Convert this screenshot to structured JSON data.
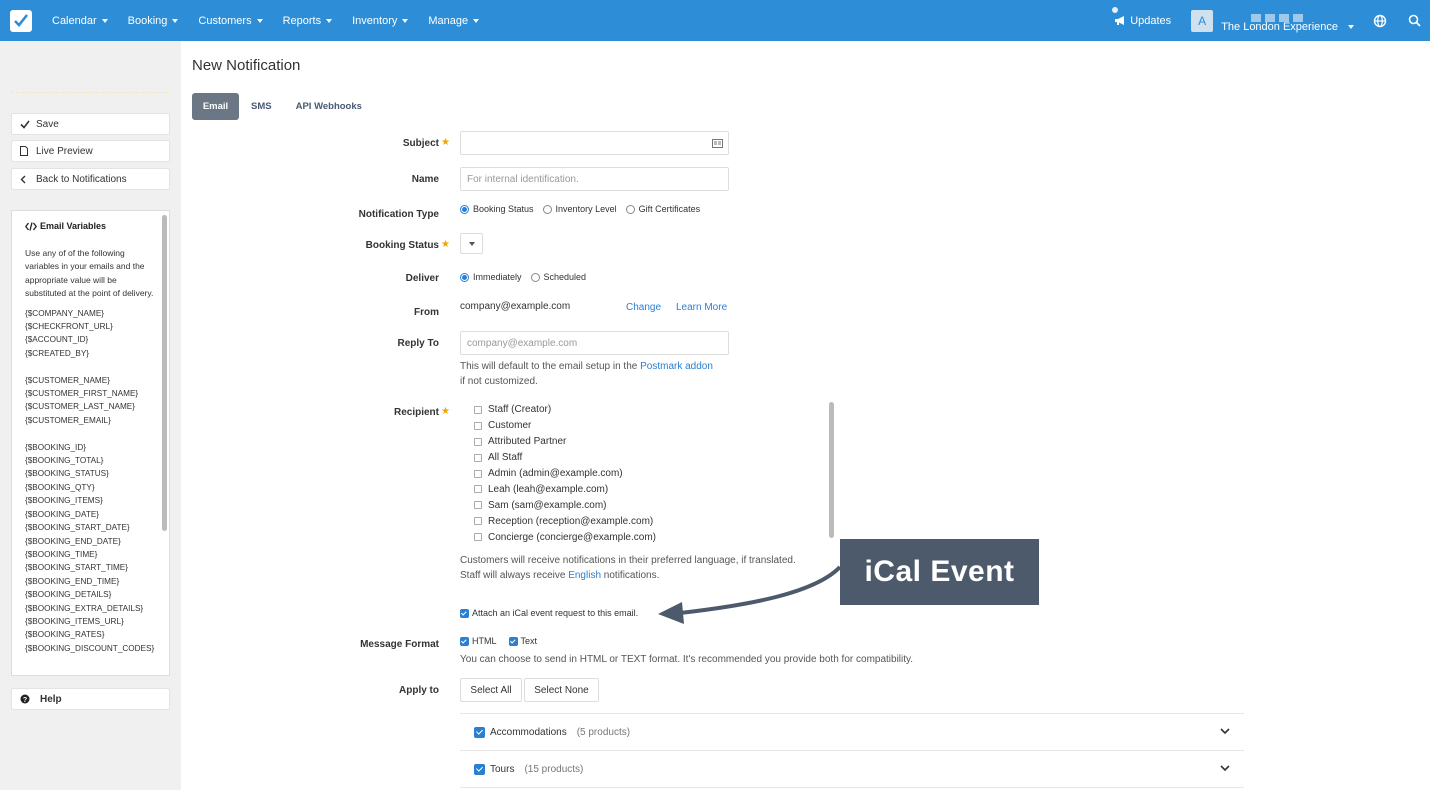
{
  "nav": {
    "items": [
      "Calendar",
      "Booking",
      "Customers",
      "Reports",
      "Inventory",
      "Manage"
    ],
    "updates_label": "Updates",
    "avatar_letter": "A",
    "account_name": "The London Experience"
  },
  "sidebar": {
    "save_label": "Save",
    "preview_label": "Live Preview",
    "back_label": "Back to Notifications",
    "vars_title": "Email Variables",
    "vars_desc": "Use any of of the following variables in your emails and the appropriate value will be substituted at the point of delivery.",
    "var_groups": [
      [
        "{$COMPANY_NAME}",
        "{$CHECKFRONT_URL}",
        "{$ACCOUNT_ID}",
        "{$CREATED_BY}"
      ],
      [
        "{$CUSTOMER_NAME}",
        "{$CUSTOMER_FIRST_NAME}",
        "{$CUSTOMER_LAST_NAME}",
        "{$CUSTOMER_EMAIL}"
      ],
      [
        "{$BOOKING_ID}",
        "{$BOOKING_TOTAL}",
        "{$BOOKING_STATUS}",
        "{$BOOKING_QTY}",
        "{$BOOKING_ITEMS}",
        "{$BOOKING_DATE}",
        "{$BOOKING_START_DATE}",
        "{$BOOKING_END_DATE}",
        "{$BOOKING_TIME}",
        "{$BOOKING_START_TIME}",
        "{$BOOKING_END_TIME}",
        "{$BOOKING_DETAILS}",
        "{$BOOKING_EXTRA_DETAILS}",
        "{$BOOKING_ITEMS_URL}",
        "{$BOOKING_RATES}",
        "{$BOOKING_DISCOUNT_CODES}"
      ]
    ],
    "help_label": "Help"
  },
  "page": {
    "title": "New Notification",
    "tabs": [
      "Email",
      "SMS",
      "API Webhooks"
    ]
  },
  "form": {
    "subject_label": "Subject",
    "subject_value": "",
    "name_label": "Name",
    "name_placeholder": "For internal identification.",
    "type_label": "Notification Type",
    "type_options": [
      "Booking Status",
      "Inventory Level",
      "Gift Certificates"
    ],
    "status_label": "Booking Status",
    "deliver_label": "Deliver",
    "deliver_options": [
      "Immediately",
      "Scheduled"
    ],
    "from_label": "From",
    "from_value": "company@example.com",
    "change_link": "Change",
    "learn_more_link": "Learn More",
    "reply_label": "Reply To",
    "reply_placeholder": "company@example.com",
    "reply_help_1": "This will default to the email setup in the",
    "reply_help_link": "Postmark addon",
    "reply_help_2": "if not customized.",
    "recipient_label": "Recipient",
    "recipients": [
      "Staff (Creator)",
      "Customer",
      "Attributed Partner",
      "All Staff",
      "Admin (admin@example.com)",
      "Leah (leah@example.com)",
      "Sam (sam@example.com)",
      "Reception (reception@example.com)",
      "Concierge (concierge@example.com)"
    ],
    "lang_note_1": "Customers will receive notifications in their preferred language, if translated.",
    "lang_note_2a": "Staff will always receive",
    "lang_note_link": "English",
    "lang_note_2b": "notifications.",
    "ical_label": "Attach an iCal event request to this email.",
    "format_label": "Message Format",
    "format_html": "HTML",
    "format_text": "Text",
    "format_help": "You can choose to send in HTML or TEXT format. It's recommended you provide both for compatibility.",
    "apply_label": "Apply to",
    "select_all": "Select All",
    "select_none": "Select None",
    "categories": [
      {
        "name": "Accommodations",
        "count": "(5 products)"
      },
      {
        "name": "Tours",
        "count": "(15 products)"
      }
    ]
  },
  "annotation": {
    "text": "iCal Event"
  },
  "colors": {
    "nav_bg": "#2d8dd6",
    "accent": "#2a7fd1",
    "required": "#f0a500",
    "callout_bg": "#4d5a6b"
  }
}
